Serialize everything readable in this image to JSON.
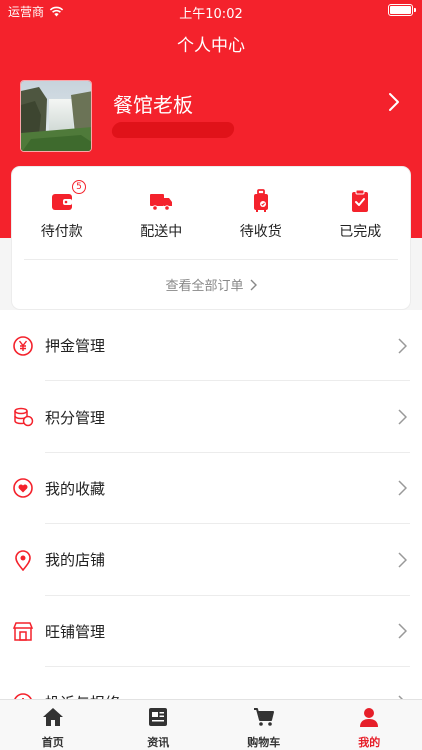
{
  "status_bar": {
    "carrier": "运营商",
    "time": "上午10:02"
  },
  "nav": {
    "title": "个人中心"
  },
  "profile": {
    "name": "餐馆老板"
  },
  "orders": {
    "items": [
      {
        "label": "待付款",
        "icon": "wallet-icon",
        "badge": "5"
      },
      {
        "label": "配送中",
        "icon": "truck-icon"
      },
      {
        "label": "待收货",
        "icon": "luggage-icon"
      },
      {
        "label": "已完成",
        "icon": "clipboard-check-icon"
      }
    ],
    "view_all": "查看全部订单"
  },
  "menu": {
    "items": [
      {
        "label": "押金管理",
        "icon": "yuan-icon"
      },
      {
        "label": "积分管理",
        "icon": "coins-icon"
      },
      {
        "label": "我的收藏",
        "icon": "heart-icon"
      },
      {
        "label": "我的店铺",
        "icon": "location-pin-icon"
      },
      {
        "label": "旺铺管理",
        "icon": "store-icon"
      },
      {
        "label": "投诉与报修",
        "icon": "alert-icon"
      }
    ]
  },
  "tabs": [
    {
      "label": "首页",
      "icon": "home-icon"
    },
    {
      "label": "资讯",
      "icon": "news-icon"
    },
    {
      "label": "购物车",
      "icon": "cart-icon"
    },
    {
      "label": "我的",
      "icon": "user-icon",
      "active": true
    }
  ],
  "colors": {
    "accent": "#f4222c",
    "tab_active": "#e61f29"
  }
}
